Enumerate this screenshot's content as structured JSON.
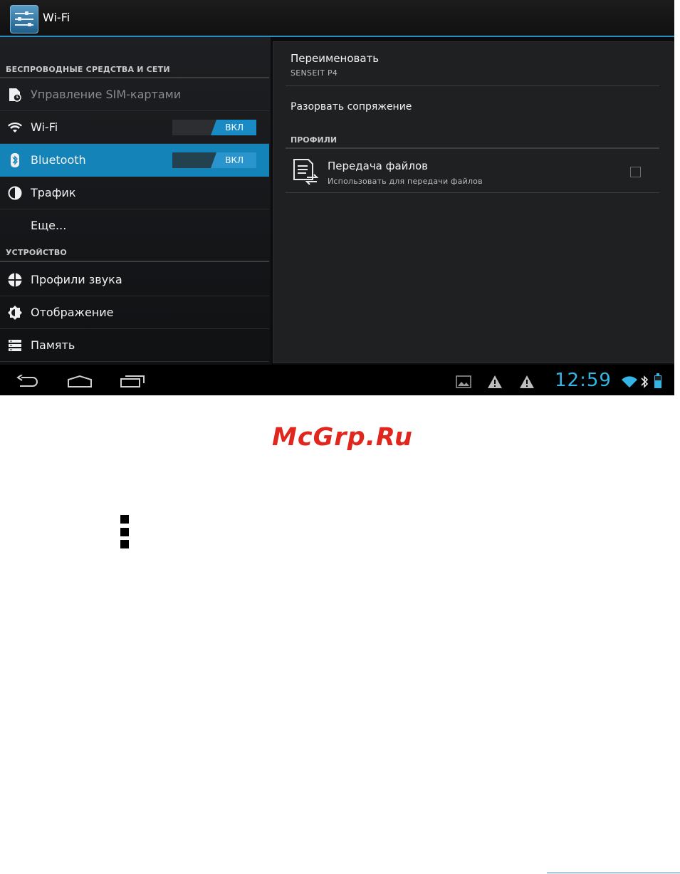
{
  "actionbar": {
    "title": "Wi-Fi",
    "icon": "settings-sliders-icon"
  },
  "left_pane": {
    "section_wireless": "БЕСПРОВОДНЫЕ СРЕДСТВА И СЕТИ",
    "section_device": "УСТРОЙСТВО",
    "items": [
      {
        "label": "Управление SIM-картами",
        "icon": "sim-card-icon",
        "enabled": false
      },
      {
        "label": "Wi-Fi",
        "icon": "wifi-icon",
        "toggle": "ВКЛ"
      },
      {
        "label": "Bluetooth",
        "icon": "bluetooth-icon",
        "toggle": "ВКЛ",
        "selected": true
      },
      {
        "label": "Трафик",
        "icon": "data-usage-icon"
      },
      {
        "label": "Еще...",
        "icon": ""
      },
      {
        "label": "Профили звука",
        "icon": "sound-profile-icon"
      },
      {
        "label": "Отображение",
        "icon": "display-brightness-icon"
      },
      {
        "label": "Память",
        "icon": "storage-icon"
      }
    ]
  },
  "right_pane": {
    "rename": {
      "title": "Переименовать",
      "device_name": "SENSEIT P4"
    },
    "unpair": "Разорвать сопряжение",
    "profiles_section": "ПРОФИЛИ",
    "file_transfer": {
      "title": "Передача файлов",
      "subtitle": "Использовать для передачи файлов",
      "checked": false
    }
  },
  "navbar": {
    "back": "back-icon",
    "home": "home-icon",
    "recents": "recent-apps-icon",
    "clock": "12:59"
  },
  "watermark": "McGrp.Ru",
  "colors": {
    "accent": "#33b5e5",
    "selected": "#1483b7",
    "watermark": "#e0261d"
  }
}
